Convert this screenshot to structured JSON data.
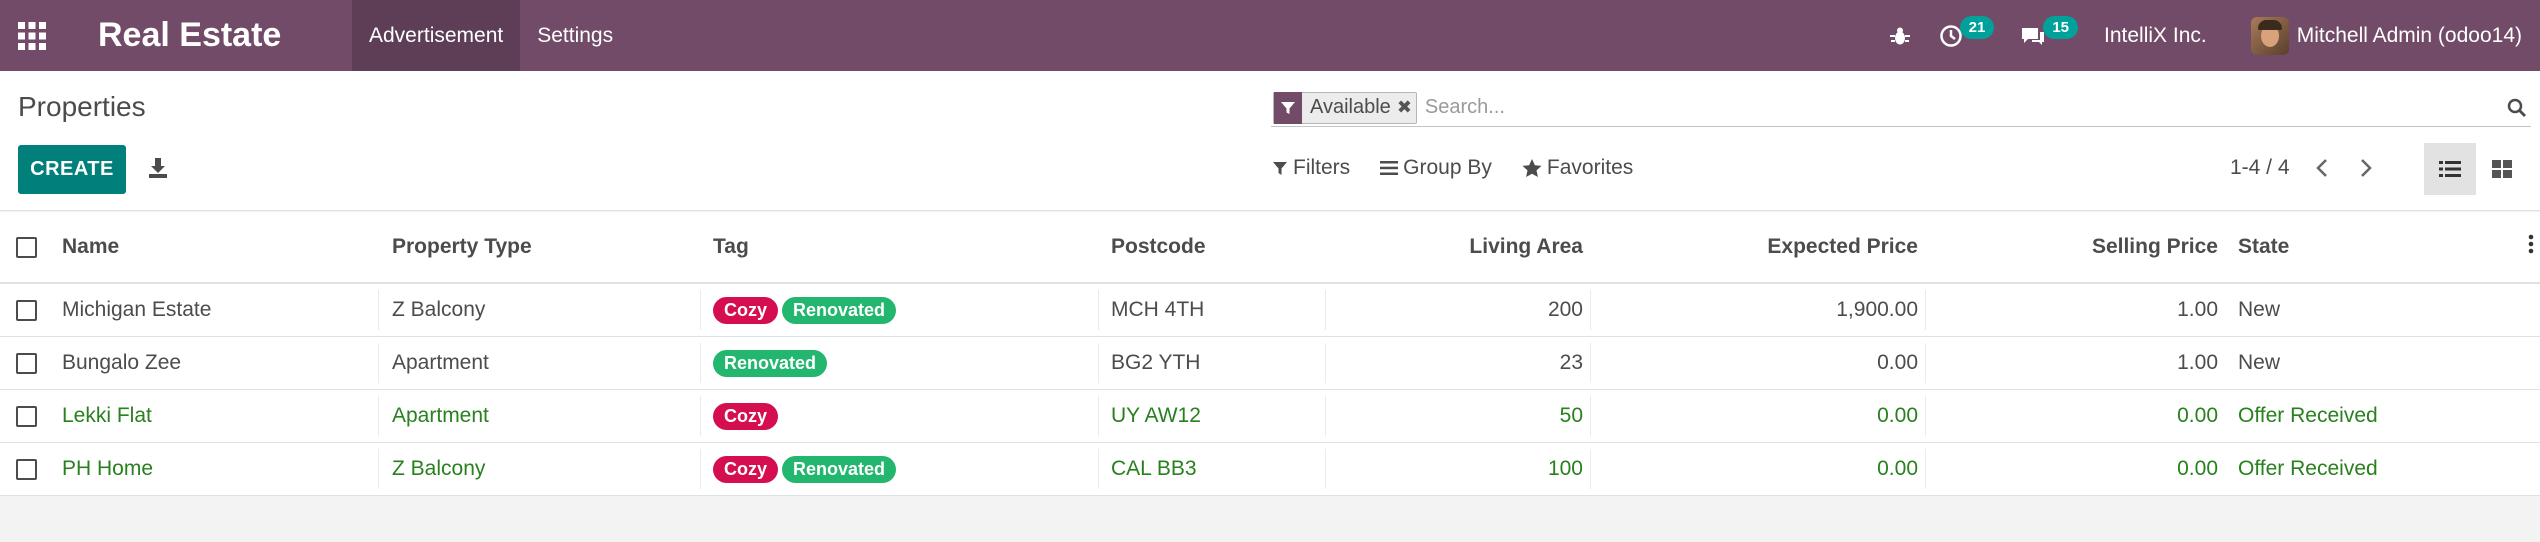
{
  "app": {
    "title": "Real Estate"
  },
  "nav": {
    "menus": [
      "Advertisement",
      "Settings"
    ]
  },
  "systray": {
    "activity_count": "21",
    "message_count": "15",
    "company": "IntelliX Inc.",
    "user": "Mitchell Admin (odoo14)"
  },
  "page": {
    "title": "Properties",
    "create_label": "CREATE"
  },
  "search": {
    "facet": "Available",
    "placeholder": "Search..."
  },
  "filters": {
    "filters": "Filters",
    "group_by": "Group By",
    "favorites": "Favorites"
  },
  "pager": {
    "value": "1-4 / 4"
  },
  "table": {
    "columns": [
      "Name",
      "Property Type",
      "Tag",
      "Postcode",
      "Living Area",
      "Expected Price",
      "Selling Price",
      "State"
    ],
    "rows": [
      {
        "name": "Michigan Estate",
        "type": "Z Balcony",
        "tags": [
          "Cozy",
          "Renovated"
        ],
        "postcode": "MCH 4TH",
        "area": "200",
        "expected": "1,900.00",
        "selling": "1.00",
        "state": "New",
        "highlight": false
      },
      {
        "name": "Bungalo Zee",
        "type": "Apartment",
        "tags": [
          "Renovated"
        ],
        "postcode": "BG2 YTH",
        "area": "23",
        "expected": "0.00",
        "selling": "1.00",
        "state": "New",
        "highlight": false
      },
      {
        "name": "Lekki Flat",
        "type": "Apartment",
        "tags": [
          "Cozy"
        ],
        "postcode": "UY AW12",
        "area": "50",
        "expected": "0.00",
        "selling": "0.00",
        "state": "Offer Received",
        "highlight": true
      },
      {
        "name": "PH Home",
        "type": "Z Balcony",
        "tags": [
          "Cozy",
          "Renovated"
        ],
        "postcode": "CAL BB3",
        "area": "100",
        "expected": "0.00",
        "selling": "0.00",
        "state": "Offer Received",
        "highlight": true
      }
    ]
  },
  "colors": {
    "navbar": "#714b67",
    "primary": "#01807b",
    "badge": "#01a19b",
    "tag_cozy": "#d40e4f",
    "tag_renovated": "#22b66f",
    "highlight_text": "#28801e"
  }
}
